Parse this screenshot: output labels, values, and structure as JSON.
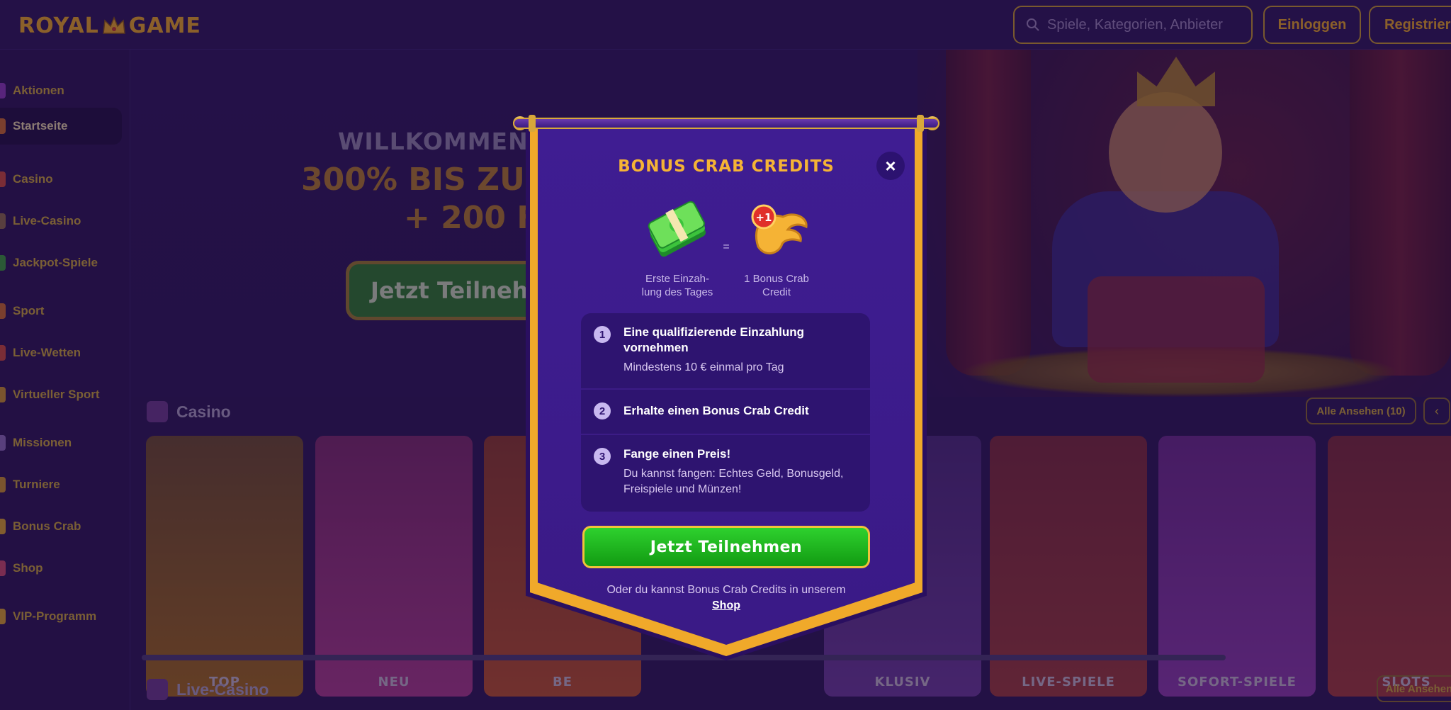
{
  "header": {
    "logo_text": "ROYAL GAME",
    "search_placeholder": "Spiele, Kategorien, Anbieter",
    "login_label": "Einloggen",
    "register_label": "Registrier"
  },
  "sidebar": {
    "items": [
      {
        "label": "Aktionen",
        "icon": "gift-icon"
      },
      {
        "label": "Startseite",
        "icon": "home-icon",
        "active": true
      },
      {
        "label": "Casino",
        "icon": "cards-icon"
      },
      {
        "label": "Live-Casino",
        "icon": "dealer-icon"
      },
      {
        "label": "Jackpot-Spiele",
        "icon": "jackpot-icon"
      },
      {
        "label": "Sport",
        "icon": "ball-icon"
      },
      {
        "label": "Live-Wetten",
        "icon": "live-icon"
      },
      {
        "label": "Virtueller Sport",
        "icon": "virtual-icon"
      },
      {
        "label": "Missionen",
        "icon": "mission-icon"
      },
      {
        "label": "Turniere",
        "icon": "trophy-icon"
      },
      {
        "label": "Bonus Crab",
        "icon": "crab-icon"
      },
      {
        "label": "Shop",
        "icon": "shop-icon"
      },
      {
        "label": "VIP-Programm",
        "icon": "vip-icon"
      }
    ]
  },
  "hero": {
    "welcome": "WILLKOMMENS",
    "offer_line1": "300% BIS ZU",
    "offer_line2": "+ 200 F",
    "cta_label": "Jetzt Teilneh"
  },
  "casino_section": {
    "title": "Casino",
    "all_label": "Alle Ansehen",
    "count": "(10)",
    "tiles": [
      "TOP",
      "NEU",
      "BE",
      "KLUSIV",
      "LIVE-SPIELE",
      "SOFORT-SPIELE",
      "SLOTS"
    ]
  },
  "live_casino_section": {
    "title": "Live-Casino",
    "all_label": "Alle Ansehen"
  },
  "modal": {
    "title": "BONUS CRAB CREDITS",
    "close_symbol": "×",
    "equals": "=",
    "caption_left_line1": "Erste Einzah-",
    "caption_left_line2": "lung des Tages",
    "caption_right_line1": "1 Bonus Crab",
    "caption_right_line2": "Credit",
    "badge": "+1",
    "steps": [
      {
        "num": "1",
        "heading": "Eine qualifizierende Einzahlung vornehmen",
        "desc": "Mindestens 10 € einmal pro Tag"
      },
      {
        "num": "2",
        "heading": "Erhalte einen Bonus Crab Credit",
        "desc": ""
      },
      {
        "num": "3",
        "heading": "Fange einen Preis!",
        "desc": "Du kannst fangen: Echtes Geld, Bonusgeld, Freispiele und Münzen!"
      }
    ],
    "cta_label": "Jetzt Teilnehmen",
    "footer_text": "Oder du kannst Bonus Crab Credits in unserem",
    "footer_link": "Shop"
  },
  "colors": {
    "accent_gold": "#f0a92a",
    "modal_bg": "#3c1b8a",
    "cta_green": "#22b822",
    "page_bg": "#2a1654"
  }
}
